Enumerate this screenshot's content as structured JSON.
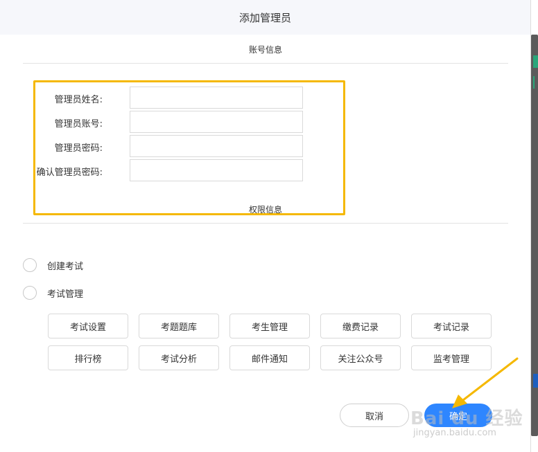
{
  "dialog": {
    "title": "添加管理员",
    "account_section_title": "账号信息",
    "permission_section_title": "权限信息"
  },
  "form": {
    "fields": [
      {
        "label": "管理员姓名:",
        "value": ""
      },
      {
        "label": "管理员账号:",
        "value": ""
      },
      {
        "label": "管理员密码:",
        "value": ""
      },
      {
        "label": "确认管理员密码:",
        "value": ""
      }
    ]
  },
  "permissions": {
    "radios": [
      {
        "label": "创建考试",
        "checked": false
      },
      {
        "label": "考试管理",
        "checked": false
      }
    ],
    "buttons_row1": [
      "考试设置",
      "考题题库",
      "考生管理",
      "缴费记录",
      "考试记录"
    ],
    "buttons_row2": [
      "排行榜",
      "考试分析",
      "邮件通知",
      "关注公众号",
      "监考管理"
    ]
  },
  "footer": {
    "cancel_label": "取消",
    "confirm_label": "确定"
  },
  "watermark": {
    "main": "Bai du 经验",
    "sub": "jingyan.baidu.com"
  },
  "colors": {
    "highlight": "#f5b800",
    "primary": "#2e86ff",
    "header_bg": "#f6f7fb",
    "arrow": "#f5b800"
  }
}
